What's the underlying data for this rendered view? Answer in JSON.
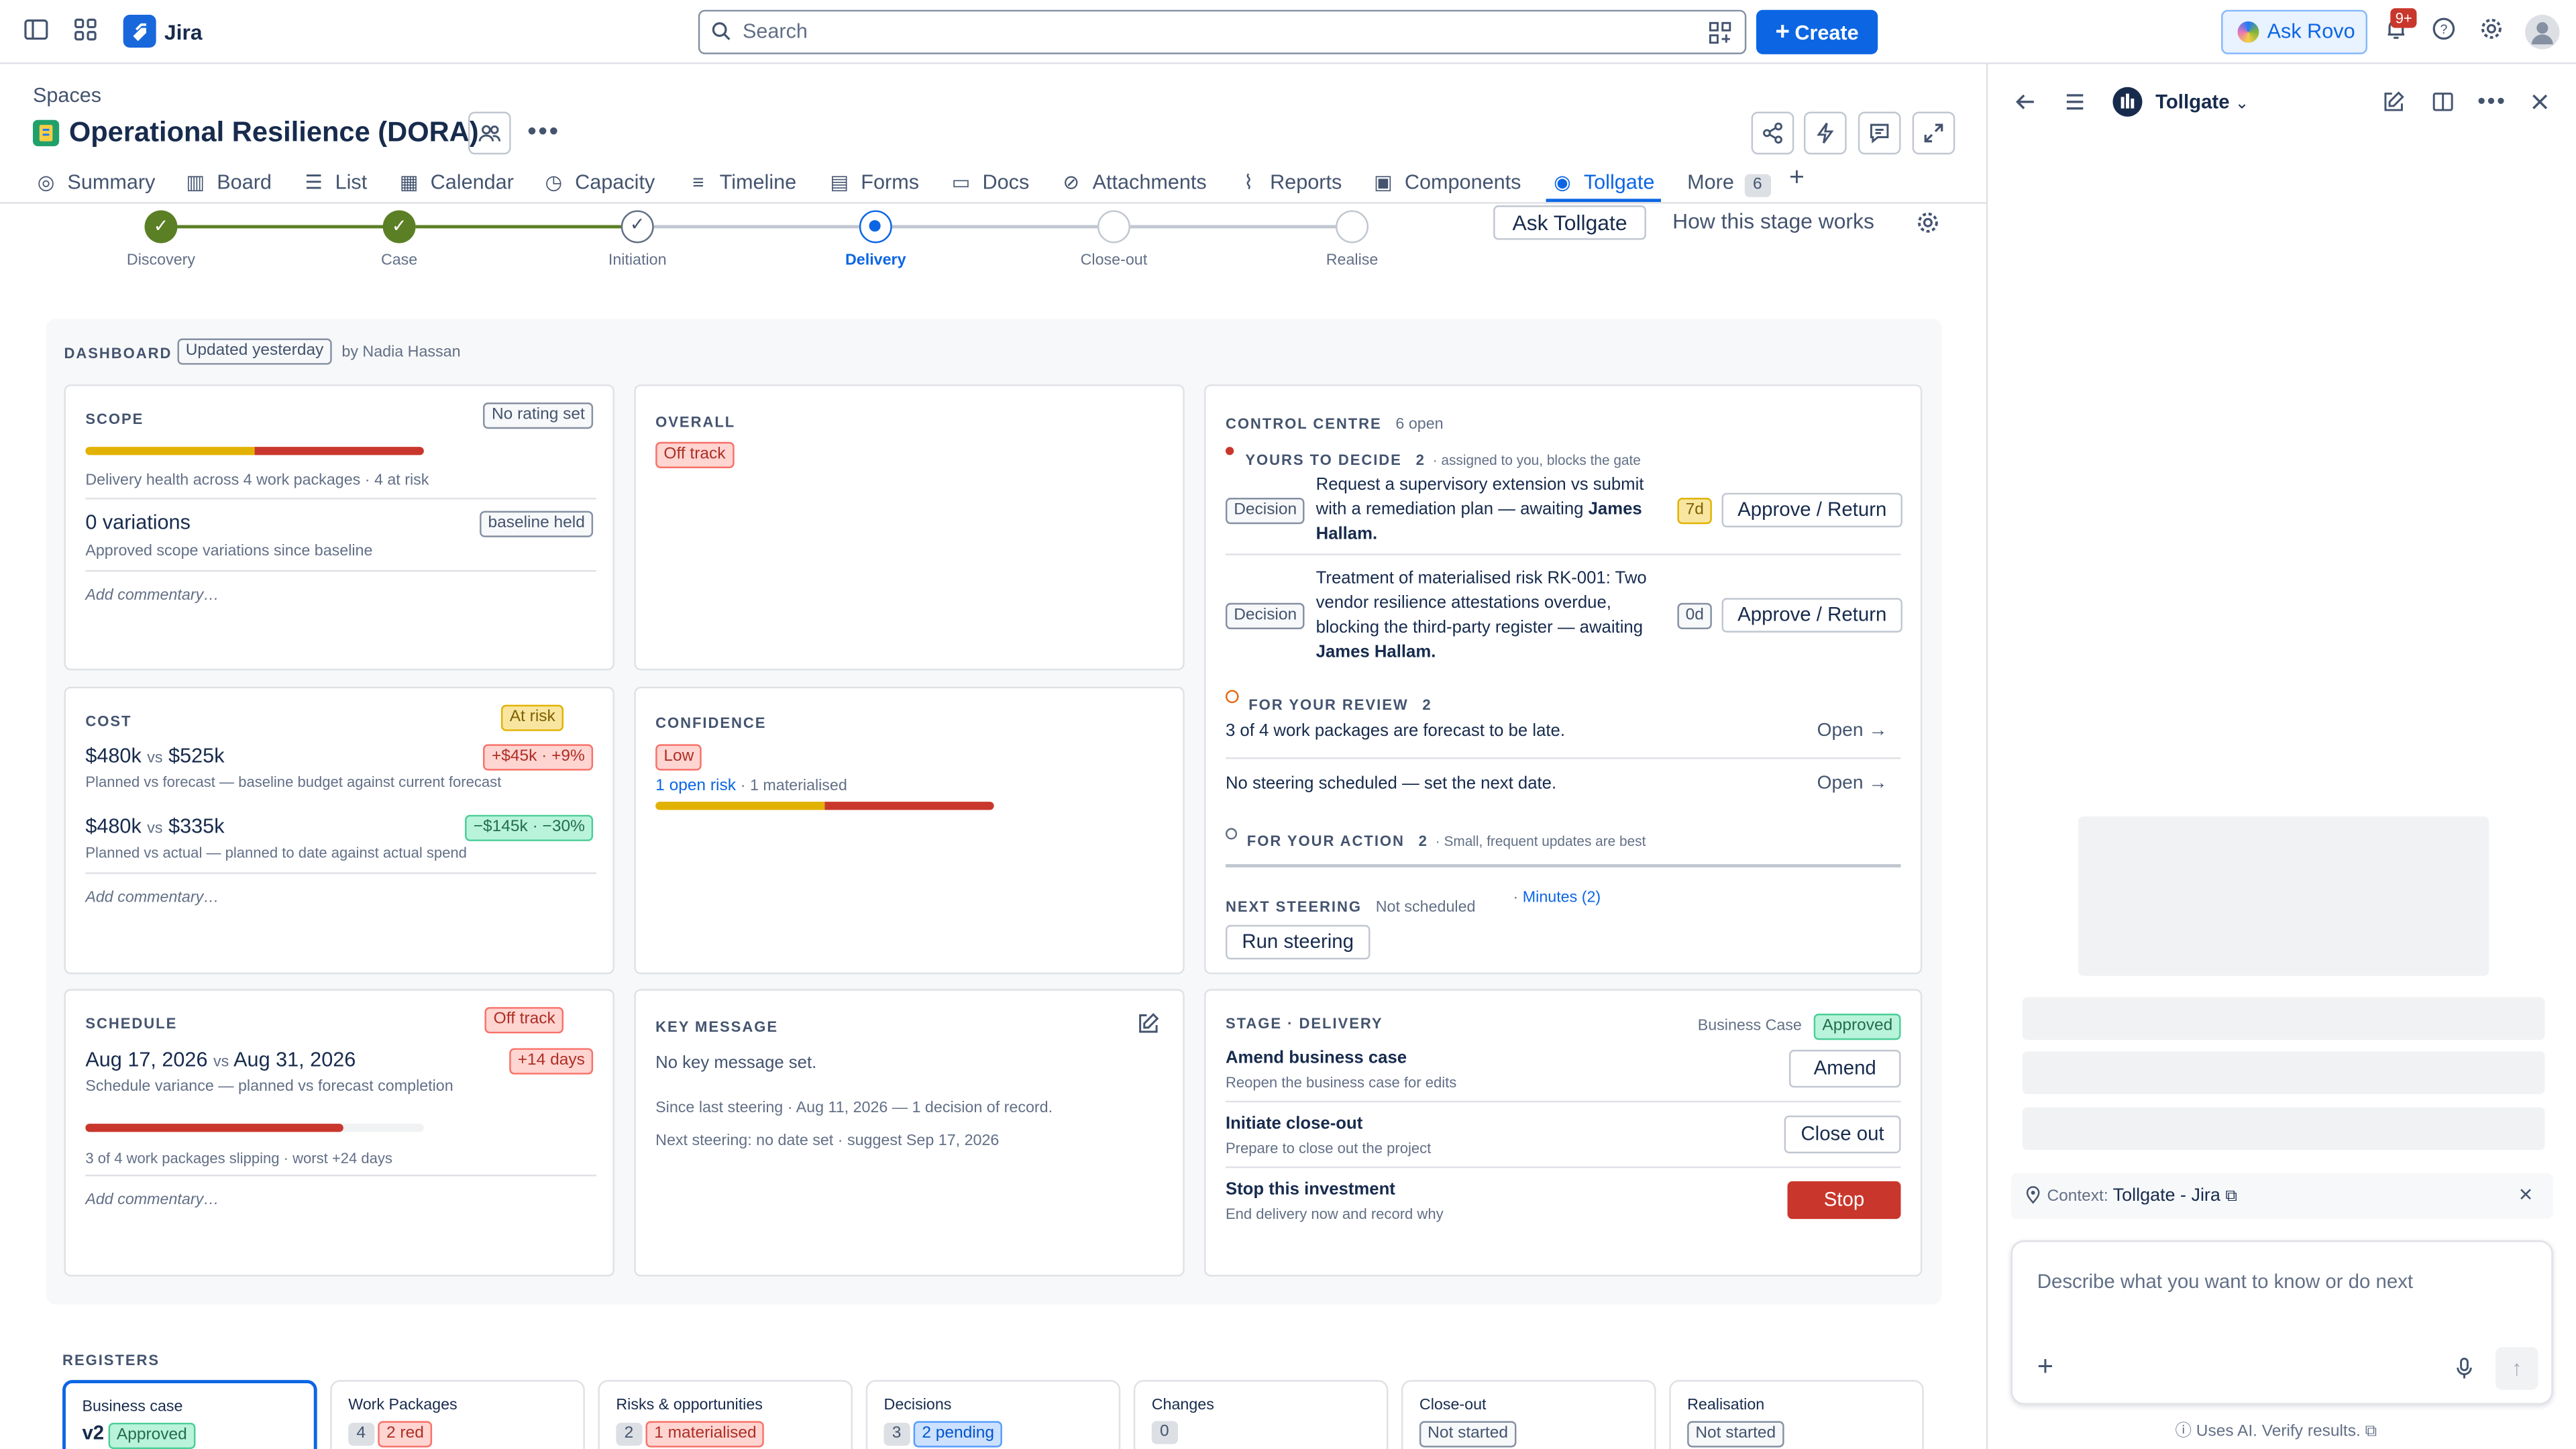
{
  "topbar": {
    "app_name": "Jira",
    "search_placeholder": "Search",
    "create_label": "Create",
    "rovo_label": "Ask Rovo",
    "notif_count": "9+"
  },
  "project": {
    "breadcrumb": "Spaces",
    "title": "Operational Resilience (DORA)"
  },
  "tabs": [
    {
      "label": "Summary"
    },
    {
      "label": "Board"
    },
    {
      "label": "List"
    },
    {
      "label": "Calendar"
    },
    {
      "label": "Capacity"
    },
    {
      "label": "Timeline"
    },
    {
      "label": "Forms"
    },
    {
      "label": "Docs"
    },
    {
      "label": "Attachments"
    },
    {
      "label": "Reports"
    },
    {
      "label": "Components"
    },
    {
      "label": "Tollgate"
    },
    {
      "label": "More"
    }
  ],
  "more_count": "6",
  "stepper": {
    "steps": [
      "Discovery",
      "Case",
      "Initiation",
      "Delivery",
      "Close-out",
      "Realise"
    ],
    "ask_label": "Ask Tollgate",
    "how_label": "How this stage works"
  },
  "dashboard": {
    "label": "DASHBOARD",
    "updated": "Updated yesterday",
    "by": "by Nadia Hassan"
  },
  "scope": {
    "title": "SCOPE",
    "rating": "No rating set",
    "health": "Delivery health across 4 work packages · 4 at risk",
    "variations": "0 variations",
    "baseline": "baseline held",
    "variations_sub": "Approved scope variations since baseline",
    "commentary": "Add commentary…"
  },
  "overall": {
    "title": "OVERALL",
    "status": "Off track"
  },
  "cost": {
    "title": "COST",
    "status": "At risk",
    "v1a": "$480k",
    "vs": "vs",
    "v1b": "$525k",
    "d1": "+$45k · +9%",
    "s1": "Planned vs forecast — baseline budget against current forecast",
    "v2a": "$480k",
    "v2b": "$335k",
    "d2": "−$145k · −30%",
    "s2": "Planned vs actual — planned to date against actual spend",
    "commentary": "Add commentary…"
  },
  "confidence": {
    "title": "CONFIDENCE",
    "status": "Low",
    "risk_link": "1 open risk",
    "risk_sub": "· 1 materialised"
  },
  "schedule": {
    "title": "SCHEDULE",
    "status": "Off track",
    "d1": "Aug 17, 2026",
    "vs": "vs",
    "d2": "Aug 31, 2026",
    "delta": "+14 days",
    "sub": "Schedule variance — planned vs forecast completion",
    "slip": "3 of 4 work packages slipping · worst +24 days",
    "commentary": "Add commentary…",
    "progress": 0.76
  },
  "key_message": {
    "title": "KEY MESSAGE",
    "text": "No key message set.",
    "since": "Since last steering · Aug 11, 2026 — 1 decision of record.",
    "next": "Next steering: no date set · suggest Sep 17, 2026"
  },
  "control": {
    "title": "CONTROL CENTRE",
    "open": "6 open",
    "yours": "YOURS TO DECIDE",
    "yours_count": "2",
    "yours_sub": "· assigned to you, blocks the gate",
    "decision_tag": "Decision",
    "d1_text": "Request a supervisory extension vs submit with a remediation plan — awaiting ",
    "d1_name": "James Hallam.",
    "d1_age": "7d",
    "d2_text": "Treatment of materialised risk RK-001: Two vendor resilience attestations overdue, blocking the third-party register — awaiting ",
    "d2_name": "James Hallam.",
    "d2_age": "0d",
    "approve": "Approve / Return",
    "review": "FOR YOUR REVIEW",
    "review_count": "2",
    "r1": "3 of 4 work packages are forecast to be late.",
    "r2": "No steering scheduled — set the next date.",
    "open_btn": "Open →",
    "action": "FOR YOUR ACTION",
    "action_count": "2",
    "action_sub": "· Small, frequent updates are best",
    "steering": "NEXT STEERING",
    "steering_val": "Not scheduled",
    "minutes": "Minutes (2)",
    "run": "Run steering"
  },
  "stage": {
    "title": "STAGE · DELIVERY",
    "bc_label": "Business Case",
    "bc_status": "Approved",
    "a1": "Amend business case",
    "a1s": "Reopen the business case for edits",
    "a1b": "Amend",
    "a2": "Initiate close-out",
    "a2s": "Prepare to close out the project",
    "a2b": "Close out",
    "a3": "Stop this investment",
    "a3s": "End delivery now and record why",
    "a3b": "Stop"
  },
  "registers": {
    "title": "REGISTERS",
    "items": [
      {
        "name": "Business case",
        "n": "v2",
        "tag": "Approved"
      },
      {
        "name": "Work Packages",
        "n": "4",
        "tag": "2 red"
      },
      {
        "name": "Risks & opportunities",
        "n": "2",
        "tag": "1 materialised"
      },
      {
        "name": "Decisions",
        "n": "3",
        "tag": "2 pending"
      },
      {
        "name": "Changes",
        "n": "0",
        "tag": ""
      },
      {
        "name": "Close-out",
        "n": "",
        "tag": "Not started"
      },
      {
        "name": "Realisation",
        "n": "",
        "tag": "Not started"
      }
    ]
  },
  "panel": {
    "title": "Tollgate",
    "context_label": "Context:",
    "context_value": "Tollgate - Jira",
    "input_placeholder": "Describe what you want to know or do next",
    "footer": "Uses AI. Verify results."
  },
  "colors": {
    "accent": "#0c66e4",
    "green": "#5b7f24",
    "red": "#c9372c",
    "yellow": "#e2b203"
  }
}
